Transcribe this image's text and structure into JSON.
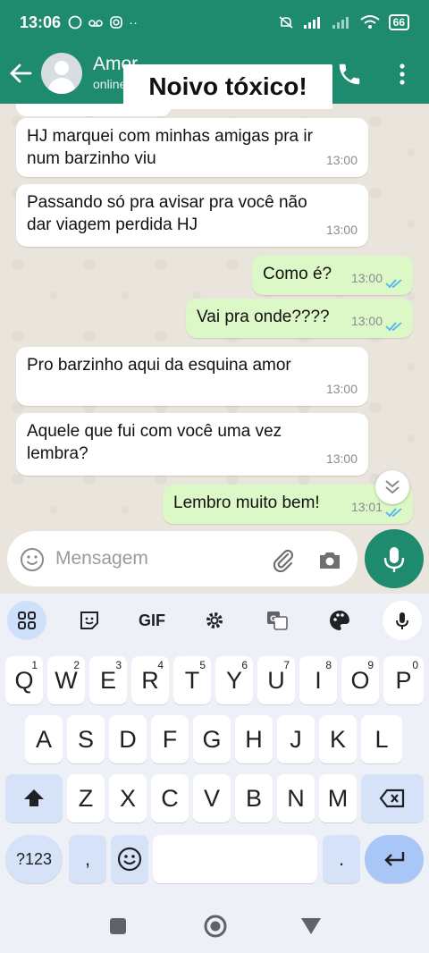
{
  "status_bar": {
    "time": "13:06",
    "battery": "66"
  },
  "header": {
    "contact_name": "Amor",
    "contact_status": "online",
    "caption": "Noivo tóxico!"
  },
  "messages": [
    {
      "direction": "in",
      "text_lines": [
        "HJ marquei com minhas amigas pra ir",
        "num barzinho viu"
      ],
      "time": "13:00"
    },
    {
      "direction": "in",
      "text_lines": [
        "Passando só pra avisar pra você não",
        "dar viagem perdida HJ"
      ],
      "time": "13:00"
    },
    {
      "direction": "out",
      "text_lines": [
        "Como é?"
      ],
      "time": "13:00",
      "read": true
    },
    {
      "direction": "out",
      "text_lines": [
        "Vai pra onde????"
      ],
      "time": "13:00",
      "read": true
    },
    {
      "direction": "in",
      "text_lines": [
        "Pro barzinho aqui da esquina amor"
      ],
      "time": "13:00"
    },
    {
      "direction": "in",
      "text_lines": [
        "Aquele que fui com você uma vez",
        "lembra?"
      ],
      "time": "13:00"
    },
    {
      "direction": "out",
      "text_lines": [
        "Lembro muito bem!"
      ],
      "time": "13:01",
      "read": true
    }
  ],
  "composer": {
    "placeholder": "Mensagem",
    "value": ""
  },
  "keyboard": {
    "toolbar": {
      "gif": "GIF"
    },
    "row1": [
      {
        "key": "Q",
        "num": "1"
      },
      {
        "key": "W",
        "num": "2"
      },
      {
        "key": "E",
        "num": "3"
      },
      {
        "key": "R",
        "num": "4"
      },
      {
        "key": "T",
        "num": "5"
      },
      {
        "key": "Y",
        "num": "6"
      },
      {
        "key": "U",
        "num": "7"
      },
      {
        "key": "I",
        "num": "8"
      },
      {
        "key": "O",
        "num": "9"
      },
      {
        "key": "P",
        "num": "0"
      }
    ],
    "row2": [
      "A",
      "S",
      "D",
      "F",
      "G",
      "H",
      "J",
      "K",
      "L"
    ],
    "row3": [
      "Z",
      "X",
      "C",
      "V",
      "B",
      "N",
      "M"
    ],
    "symbols_key": "?123",
    "comma_key": ",",
    "period_key": "."
  },
  "colors": {
    "brand": "#1e8a6e",
    "outgoing_bubble": "#dcf8c6",
    "read_ticks": "#4fb6ec"
  }
}
